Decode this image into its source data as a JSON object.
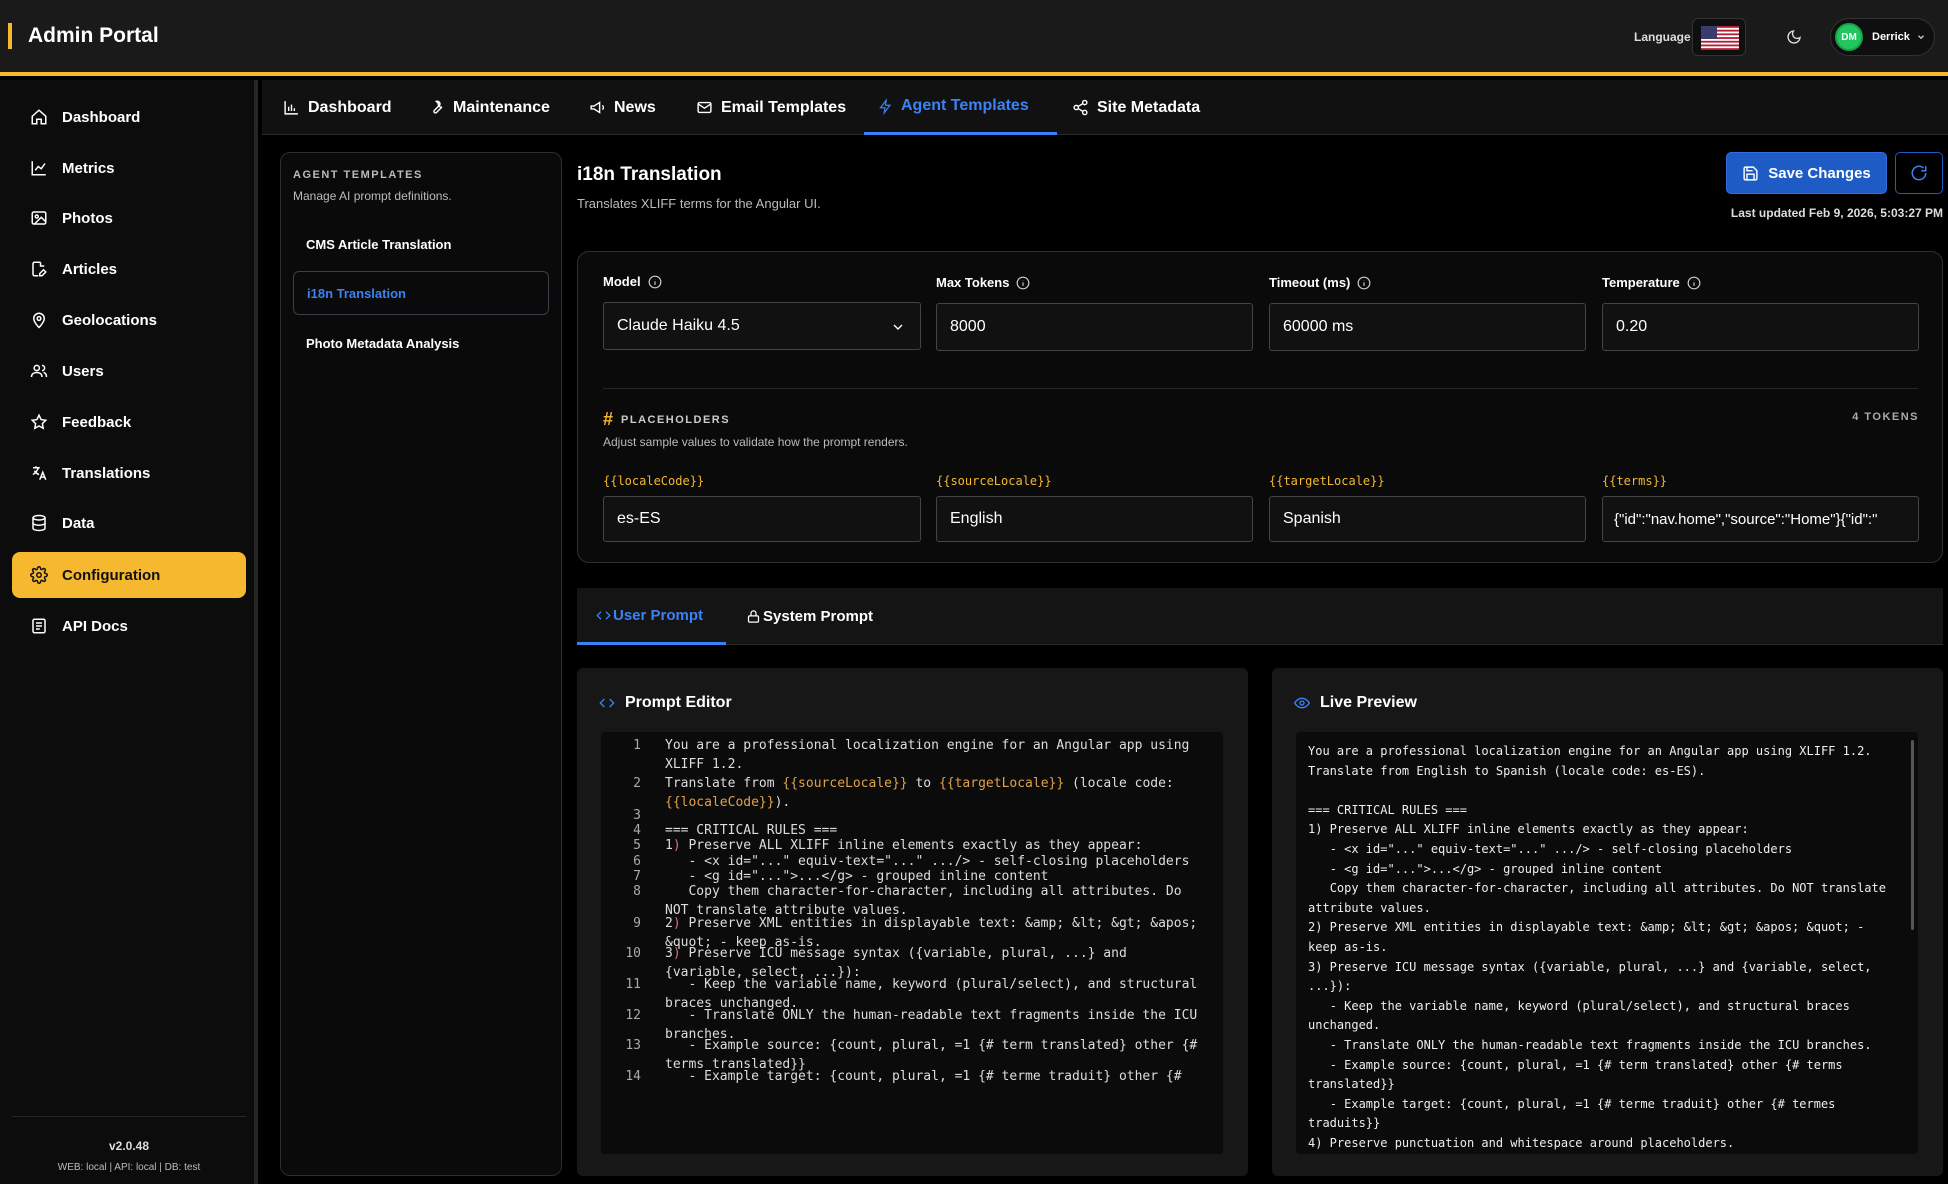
{
  "header": {
    "title": "Admin Portal",
    "language_label": "Language",
    "user_initials": "DM",
    "user_name": "Derrick"
  },
  "sidebar": {
    "items": [
      {
        "label": "Dashboard",
        "icon": "home-icon"
      },
      {
        "label": "Metrics",
        "icon": "chart-line-icon"
      },
      {
        "label": "Photos",
        "icon": "image-icon"
      },
      {
        "label": "Articles",
        "icon": "document-pen-icon"
      },
      {
        "label": "Geolocations",
        "icon": "map-pin-icon"
      },
      {
        "label": "Users",
        "icon": "users-icon"
      },
      {
        "label": "Feedback",
        "icon": "star-icon"
      },
      {
        "label": "Translations",
        "icon": "translate-icon"
      },
      {
        "label": "Data",
        "icon": "database-icon"
      },
      {
        "label": "Configuration",
        "icon": "gear-icon",
        "active": true
      },
      {
        "label": "API Docs",
        "icon": "book-icon"
      }
    ],
    "version": "v2.0.48",
    "environments": "WEB: local  |  API: local  |  DB: test"
  },
  "tabs": [
    {
      "label": "Dashboard",
      "icon": "bar-chart-icon"
    },
    {
      "label": "Maintenance",
      "icon": "wrench-icon"
    },
    {
      "label": "News",
      "icon": "megaphone-icon"
    },
    {
      "label": "Email Templates",
      "icon": "mail-icon"
    },
    {
      "label": "Agent Templates",
      "icon": "lightning-icon",
      "active": true
    },
    {
      "label": "Site Metadata",
      "icon": "share-icon"
    }
  ],
  "templates": {
    "heading": "AGENT TEMPLATES",
    "subheading": "Manage AI prompt definitions.",
    "items": [
      {
        "label": "CMS Article Translation"
      },
      {
        "label": "i18n Translation",
        "active": true
      },
      {
        "label": "Photo Metadata Analysis"
      }
    ]
  },
  "main": {
    "title": "i18n Translation",
    "description": "Translates XLIFF terms for the Angular UI.",
    "save_label": "Save Changes",
    "last_updated": "Last updated Feb 9, 2026, 5:03:27 PM"
  },
  "config": {
    "model_label": "Model",
    "model_value": "Claude Haiku 4.5",
    "max_tokens_label": "Max Tokens",
    "max_tokens_value": "8000",
    "timeout_label": "Timeout (ms)",
    "timeout_value": "60000 ms",
    "temperature_label": "Temperature",
    "temperature_value": "0.20"
  },
  "placeholders": {
    "heading": "PLACEHOLDERS",
    "subheading": "Adjust sample values to validate how the prompt renders.",
    "token_count": "4 TOKENS",
    "items": [
      {
        "label": "{{localeCode}}",
        "value": "es-ES"
      },
      {
        "label": "{{sourceLocale}}",
        "value": "English"
      },
      {
        "label": "{{targetLocale}}",
        "value": "Spanish"
      },
      {
        "label": "{{terms}}",
        "value": "{\"id\":\"nav.home\",\"source\":\"Home\"}{\"id\":\""
      }
    ]
  },
  "prompt_tabs": [
    {
      "label": "User Prompt",
      "active": true
    },
    {
      "label": "System Prompt"
    }
  ],
  "editor": {
    "title": "Prompt Editor",
    "lines": [
      {
        "n": "1",
        "text": "You are a professional localization engine for an Angular app using XLIFF 1.2."
      },
      {
        "n": "2",
        "text": "Translate from {{sourceLocale}} to {{targetLocale}} (locale code: {{localeCode}})."
      },
      {
        "n": "3",
        "text": ""
      },
      {
        "n": "4",
        "text": "=== CRITICAL RULES ==="
      },
      {
        "n": "5",
        "text": "1) Preserve ALL XLIFF inline elements exactly as they appear:"
      },
      {
        "n": "6",
        "text": "   - <x id=\"...\" equiv-text=\"...\" .../> - self-closing placeholders"
      },
      {
        "n": "7",
        "text": "   - <g id=\"...\">...</g> - grouped inline content"
      },
      {
        "n": "8",
        "text": "   Copy them character-for-character, including all attributes. Do NOT translate attribute values."
      },
      {
        "n": "9",
        "text": "2) Preserve XML entities in displayable text: &amp; &lt; &gt; &apos; &quot; - keep as-is."
      },
      {
        "n": "10",
        "text": "3) Preserve ICU message syntax ({variable, plural, ...} and {variable, select, ...}):"
      },
      {
        "n": "11",
        "text": "   - Keep the variable name, keyword (plural/select), and structural braces unchanged."
      },
      {
        "n": "12",
        "text": "   - Translate ONLY the human-readable text fragments inside the ICU branches."
      },
      {
        "n": "13",
        "text": "   - Example source: {count, plural, =1 {# term translated} other {# terms translated}}"
      },
      {
        "n": "14",
        "text": "   - Example target: {count, plural, =1 {# terme traduit} other {#"
      }
    ]
  },
  "preview": {
    "title": "Live Preview",
    "text": "You are a professional localization engine for an Angular app using XLIFF 1.2.\nTranslate from English to Spanish (locale code: es-ES).\n\n=== CRITICAL RULES ===\n1) Preserve ALL XLIFF inline elements exactly as they appear:\n   - <x id=\"...\" equiv-text=\"...\" .../> - self-closing placeholders\n   - <g id=\"...\">...</g> - grouped inline content\n   Copy them character-for-character, including all attributes. Do NOT translate attribute values.\n2) Preserve XML entities in displayable text: &amp; &lt; &gt; &apos; &quot; - keep as-is.\n3) Preserve ICU message syntax ({variable, plural, ...} and {variable, select, ...}):\n   - Keep the variable name, keyword (plural/select), and structural braces unchanged.\n   - Translate ONLY the human-readable text fragments inside the ICU branches.\n   - Example source: {count, plural, =1 {# term translated} other {# terms translated}}\n   - Example target: {count, plural, =1 {# terme traduit} other {# termes traduits}}\n4) Preserve punctuation and whitespace around placeholders."
  },
  "colors": {
    "accent": "#f5b82e",
    "primary_blue": "#3b82f6",
    "save_button": "#1f5bc4",
    "placeholder_text": "#e0a24a"
  }
}
